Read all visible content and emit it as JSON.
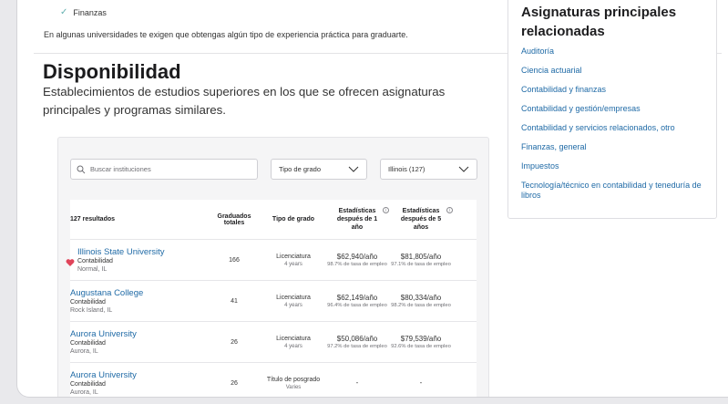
{
  "top": {
    "check_item": "Finanzas",
    "note": "En algunas universidades te exigen que obtengas algún tipo de experiencia práctica para graduarte."
  },
  "availability": {
    "title": "Disponibilidad",
    "subtitle": "Establecimientos de estudios superiores en los que se ofrecen asignaturas principales y programas similares."
  },
  "filters": {
    "search_placeholder": "Buscar instituciones",
    "degree_type": "Tipo de grado",
    "state": "Illinois (127)"
  },
  "table": {
    "headers": {
      "results": "127 resultados",
      "graduates": "Graduados totales",
      "degree": "Tipo de grado",
      "stats1": "Estadísticas después de 1 año",
      "stats5": "Estadísticas después de 5 años",
      "info": "i"
    },
    "rows": [
      {
        "name": "Illinois State University",
        "major": "Contabilidad",
        "location": "Normal, IL",
        "graduates": "166",
        "degree": "Licenciatura",
        "years": "4 years",
        "sal1": "$62,940/año",
        "emp1": "98.7% de tasa de empleo",
        "sal5": "$81,805/año",
        "emp5": "97.1% de tasa de empleo",
        "favorite": true
      },
      {
        "name": "Augustana College",
        "major": "Contabilidad",
        "location": "Rock Island, IL",
        "graduates": "41",
        "degree": "Licenciatura",
        "years": "4 years",
        "sal1": "$62,149/año",
        "emp1": "96.4% de tasa de empleo",
        "sal5": "$80,334/año",
        "emp5": "98.2% de tasa de empleo",
        "favorite": false
      },
      {
        "name": "Aurora University",
        "major": "Contabilidad",
        "location": "Aurora, IL",
        "graduates": "26",
        "degree": "Licenciatura",
        "years": "4 years",
        "sal1": "$50,086/año",
        "emp1": "97.2% de tasa de empleo",
        "sal5": "$79,539/año",
        "emp5": "92.6% de tasa de empleo",
        "favorite": false
      },
      {
        "name": "Aurora University",
        "major": "Contabilidad",
        "location": "Aurora, IL",
        "graduates": "26",
        "degree": "Título de posgrado",
        "years": "Varies",
        "sal1": "-",
        "emp1": "",
        "sal5": "-",
        "emp5": "",
        "favorite": false
      }
    ]
  },
  "sidebar": {
    "title": "Asignaturas principales relacionadas",
    "links": [
      "Auditoría",
      "Ciencia actuarial",
      "Contabilidad y finanzas",
      "Contabilidad y gestión/empresas",
      "Contabilidad y servicios relacionados, otro",
      "Finanzas, general",
      "Impuestos",
      "Tecnología/técnico en contabilidad y teneduría de libros"
    ]
  },
  "colors": {
    "link": "#1f6aa6",
    "heart": "#e0445a",
    "check": "#63b0b0"
  }
}
